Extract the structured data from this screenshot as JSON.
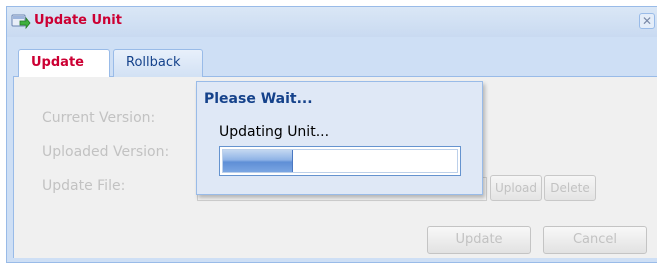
{
  "window": {
    "title": "Update Unit",
    "icon": "update-unit-icon",
    "close_icon": "close-icon"
  },
  "tabs": [
    {
      "label": "Update",
      "active": true
    },
    {
      "label": "Rollback",
      "active": false
    }
  ],
  "form": {
    "current_version_label": "Current Version:",
    "uploaded_version_label": "Uploaded Version:",
    "update_file_label": "Update File:",
    "update_file_value": ".",
    "upload_label": "Upload",
    "delete_label": "Delete",
    "update_label": "Update",
    "cancel_label": "Cancel"
  },
  "wait_dialog": {
    "title": "Please Wait...",
    "message": "Updating Unit...",
    "progress_fraction": 0.3
  },
  "colors": {
    "title_accent": "#cc0033",
    "panel_border": "#99bbe8",
    "disabled_text": "#c2c2c2"
  }
}
